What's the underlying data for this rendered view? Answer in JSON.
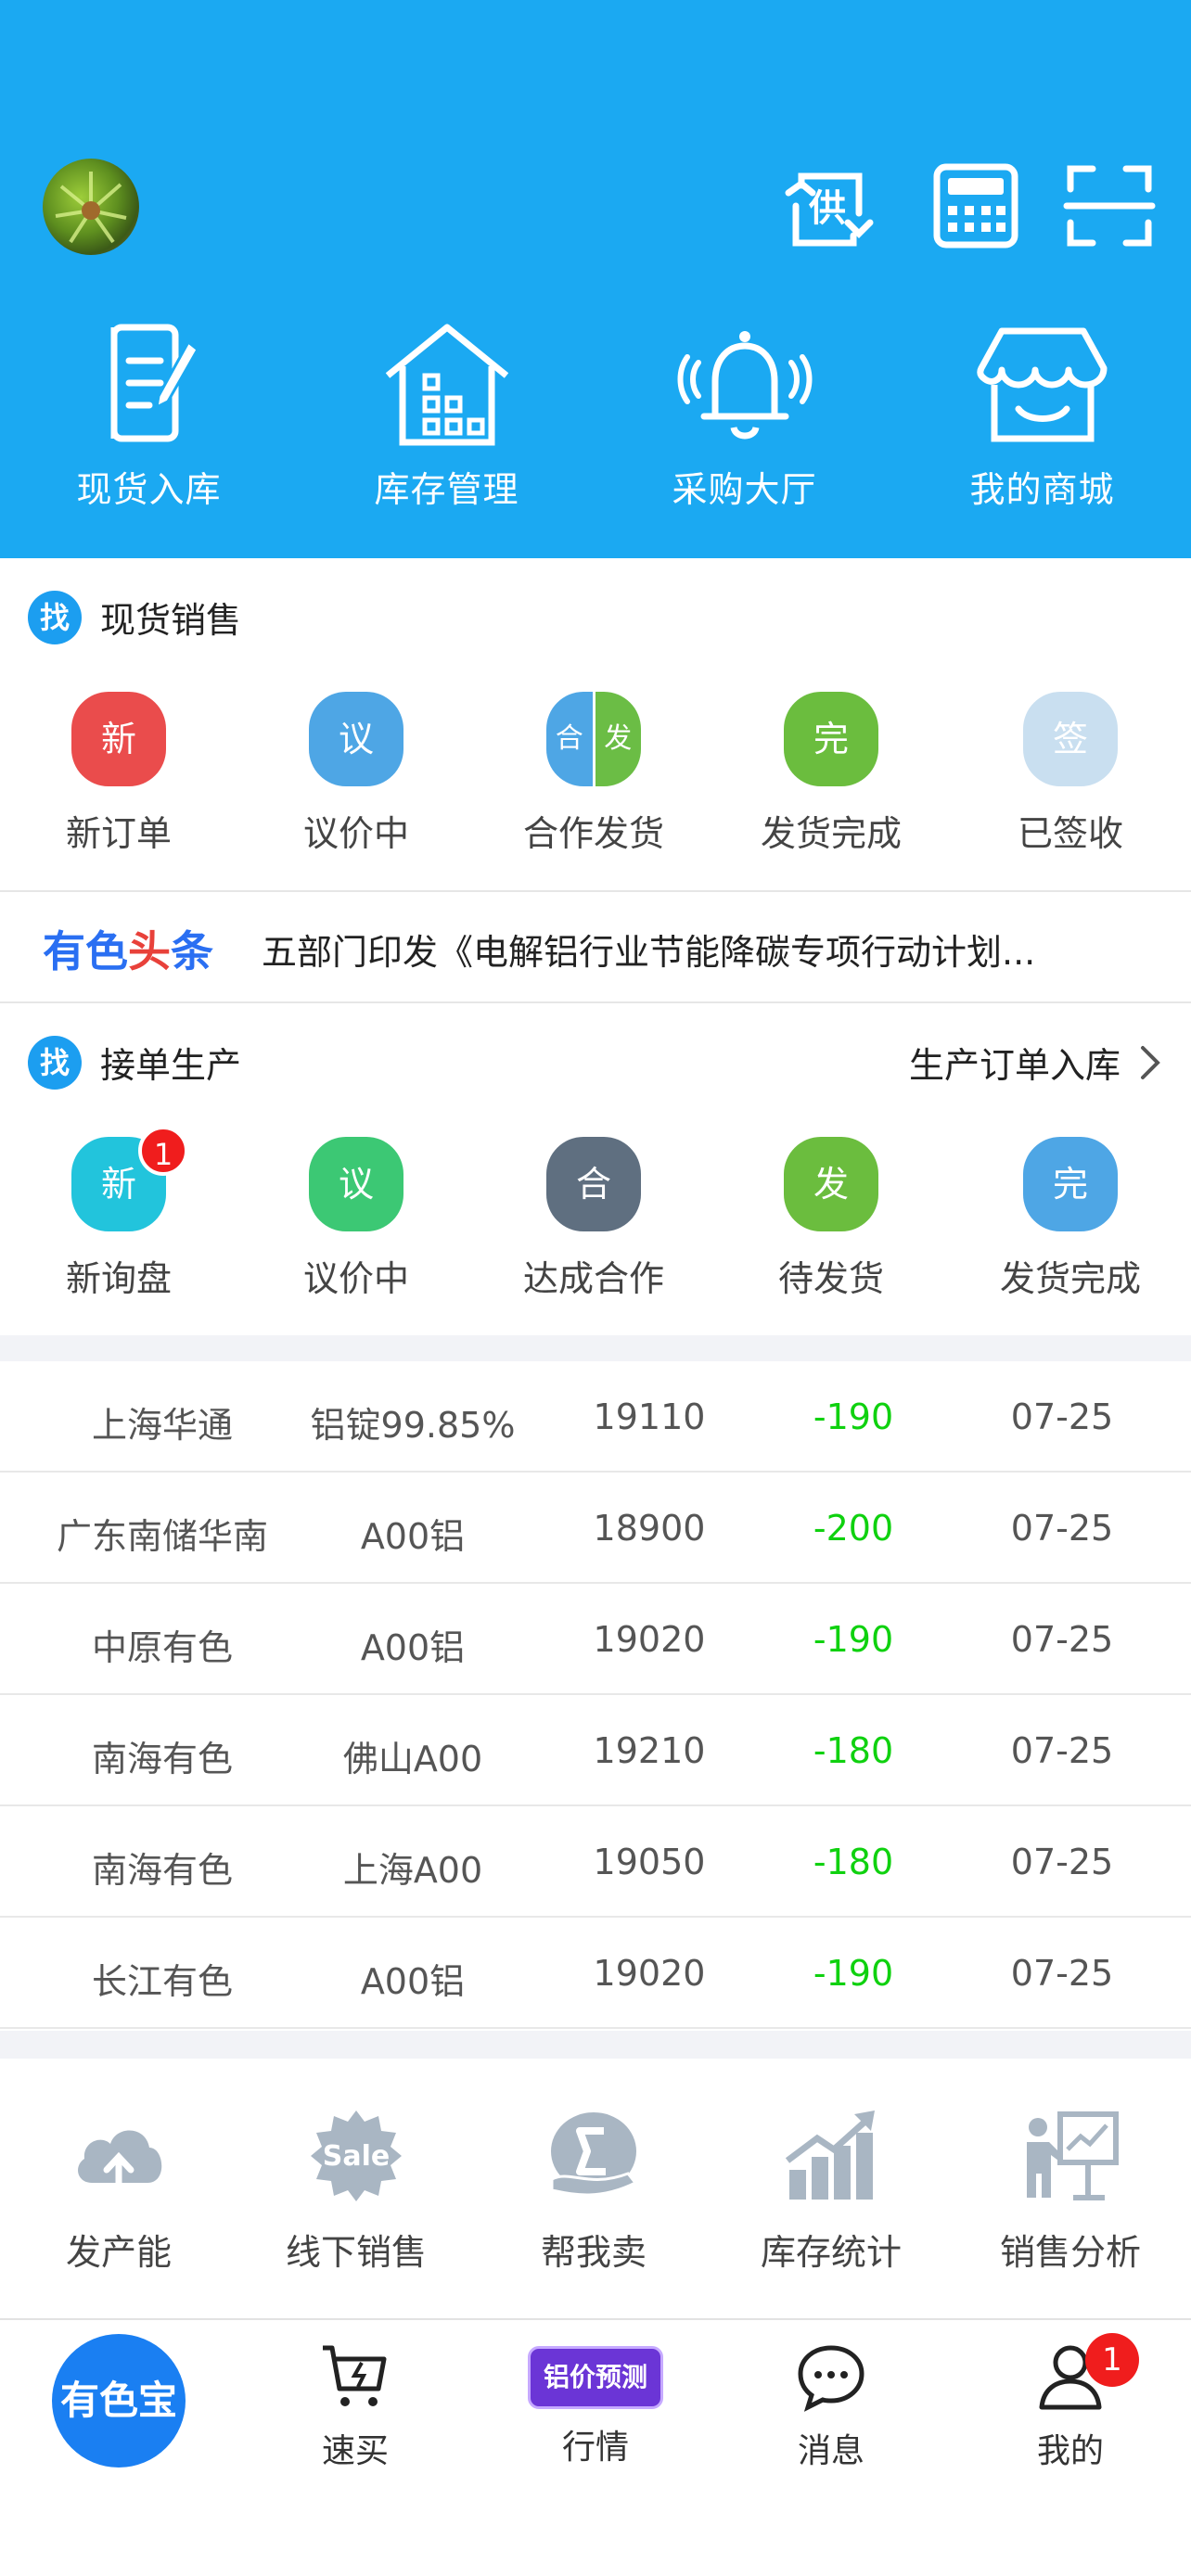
{
  "header": {
    "quick_actions": [
      {
        "label": "现货入库",
        "icon": "document-edit-icon"
      },
      {
        "label": "库存管理",
        "icon": "warehouse-icon"
      },
      {
        "label": "采购大厅",
        "icon": "bell-icon"
      },
      {
        "label": "我的商城",
        "icon": "shop-icon"
      }
    ],
    "supply_icon_text": "供"
  },
  "spot_sales": {
    "badge": "找",
    "title": "现货销售",
    "statuses": [
      {
        "char": "新",
        "label": "新订单",
        "color": "#ea4c4c"
      },
      {
        "char": "议",
        "label": "议价中",
        "color": "#4ea6e5"
      },
      {
        "char_left": "合",
        "char_right": "发",
        "label": "合作发货",
        "color_left": "#4ea6e5",
        "color_right": "#6bbd45"
      },
      {
        "char": "完",
        "label": "发货完成",
        "color": "#6bbd3e"
      },
      {
        "char": "签",
        "label": "已签收",
        "color": "#c9dff0"
      }
    ]
  },
  "news": {
    "brand_1": "有色",
    "brand_2": "头",
    "brand_3": "条",
    "headline": "五部门印发《电解铝行业节能降碳专项行动计划..."
  },
  "production": {
    "badge": "找",
    "title": "接单生产",
    "link": "生产订单入库",
    "statuses": [
      {
        "char": "新",
        "label": "新询盘",
        "color": "#22c4dc",
        "badge": "1"
      },
      {
        "char": "议",
        "label": "议价中",
        "color": "#3cc874"
      },
      {
        "char": "合",
        "label": "达成合作",
        "color": "#5f6f80"
      },
      {
        "char": "发",
        "label": "待发货",
        "color": "#6bbd3e"
      },
      {
        "char": "完",
        "label": "发货完成",
        "color": "#4ea6e5"
      }
    ]
  },
  "prices": [
    {
      "market": "上海华通",
      "product": "铝锭99.85%",
      "price": "19110",
      "change": "-190",
      "date": "07-25"
    },
    {
      "market": "广东南储华南",
      "product": "A00铝",
      "price": "18900",
      "change": "-200",
      "date": "07-25"
    },
    {
      "market": "中原有色",
      "product": "A00铝",
      "price": "19020",
      "change": "-190",
      "date": "07-25"
    },
    {
      "market": "南海有色",
      "product": "佛山A00",
      "price": "19210",
      "change": "-180",
      "date": "07-25"
    },
    {
      "market": "南海有色",
      "product": "上海A00",
      "price": "19050",
      "change": "-180",
      "date": "07-25"
    },
    {
      "market": "长江有色",
      "product": "A00铝",
      "price": "19020",
      "change": "-190",
      "date": "07-25"
    }
  ],
  "tools": [
    {
      "label": "发产能",
      "icon": "cloud-upload-icon"
    },
    {
      "label": "线下销售",
      "icon": "sale-badge-icon",
      "icon_text": "Sale"
    },
    {
      "label": "帮我卖",
      "icon": "hand-e-icon"
    },
    {
      "label": "库存统计",
      "icon": "bar-growth-icon"
    },
    {
      "label": "销售分析",
      "icon": "presenter-chart-icon"
    }
  ],
  "tabbar": {
    "home": "有色宝",
    "tabs": [
      {
        "label": "速买",
        "icon": "cart-bolt-icon"
      },
      {
        "label": "行情",
        "badge_text": "铝价预测"
      },
      {
        "label": "消息",
        "icon": "chat-bubble-icon"
      },
      {
        "label": "我的",
        "icon": "user-icon",
        "badge": "1"
      }
    ]
  }
}
